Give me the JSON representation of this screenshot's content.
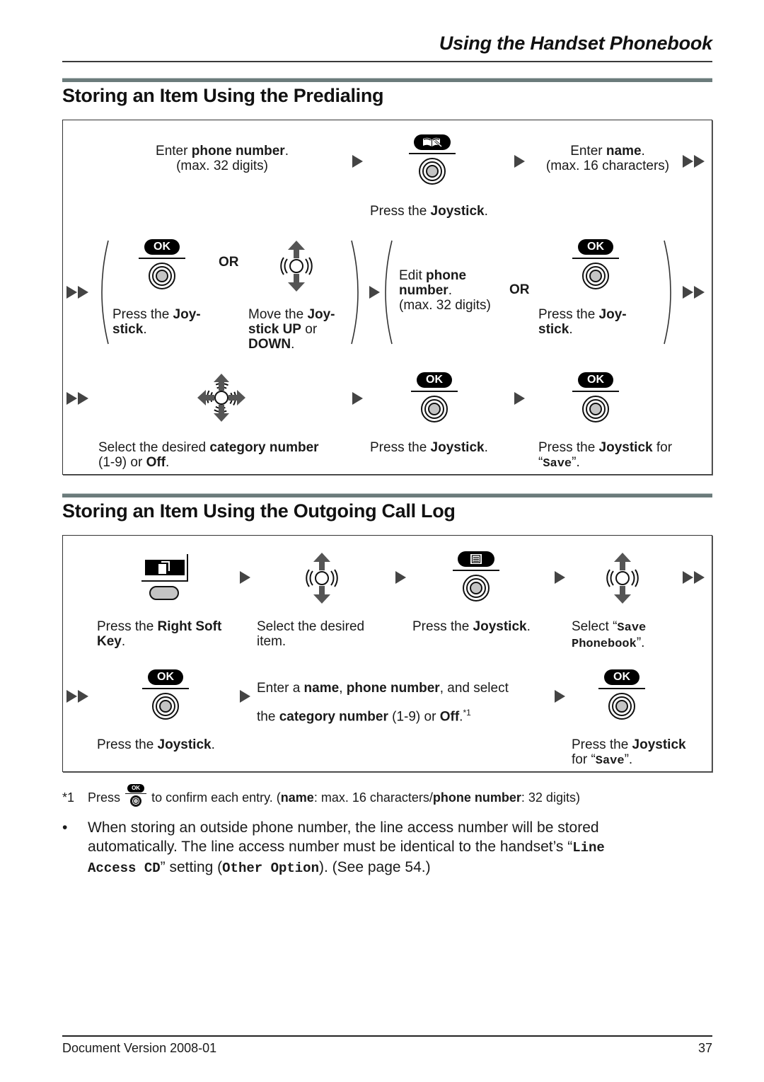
{
  "header": {
    "title": "Using the Handset Phonebook"
  },
  "section1": {
    "title": "Storing an Item Using the Predialing",
    "row1": {
      "step1": {
        "prefix": "Enter ",
        "bold": "phone number",
        "suffix": ".",
        "line2": "(max. 32 digits)"
      },
      "step2": {
        "icon": "phonebook-key-icon",
        "prefix": "Press the ",
        "bold": "Joystick",
        "suffix": "."
      },
      "step3": {
        "prefix": "Enter ",
        "bold": "name",
        "suffix": ".",
        "line2": "(max. 16 characters)"
      }
    },
    "row2": {
      "optA": {
        "key_label": "OK",
        "line1_prefix": "Press the ",
        "line1_bold": "Joy-",
        "line2_bold": "stick",
        "line2_suffix": "."
      },
      "or1": "OR",
      "optB": {
        "line1_prefix": "Move the ",
        "line1_bold": "Joy-",
        "line2_bold": "stick UP",
        "line2_suffix": " or",
        "line3_bold": "DOWN",
        "line3_suffix": "."
      },
      "optC": {
        "line1_prefix": "Edit ",
        "line1_bold": "phone",
        "line2_bold": "number",
        "line2_suffix": ".",
        "line3": "(max. 32 digits)"
      },
      "or2": "OR",
      "optD": {
        "key_label": "OK",
        "line1_prefix": "Press the ",
        "line1_bold": "Joy-",
        "line2_bold": "stick",
        "line2_suffix": "."
      }
    },
    "row3": {
      "step1": {
        "prefix": "Select the desired ",
        "bold": "category number",
        "line2_prefix": "(1-9) or ",
        "line2_bold": "Off",
        "line2_suffix": "."
      },
      "step2": {
        "key_label": "OK",
        "prefix": "Press the ",
        "bold": "Joystick",
        "suffix": "."
      },
      "step3": {
        "key_label": "OK",
        "prefix": "Press the ",
        "bold": "Joystick",
        "suffix": " for",
        "line2_open": "“",
        "line2_mono": "Save",
        "line2_close": "”."
      }
    }
  },
  "section2": {
    "title": "Storing an Item Using the Outgoing Call Log",
    "row1": {
      "step1": {
        "prefix": "Press the ",
        "bold": "Right Soft",
        "line2_bold": "Key",
        "line2_suffix": "."
      },
      "step2": {
        "line1": "Select the desired",
        "line2": "item."
      },
      "step3": {
        "prefix": "Press the ",
        "bold": "Joystick",
        "suffix": "."
      },
      "step4": {
        "prefix": "Select “",
        "mono1": "Save",
        "mono2": "Phonebook",
        "suffix": "”."
      }
    },
    "row2": {
      "step1": {
        "key_label": "OK",
        "prefix": "Press the ",
        "bold": "Joystick",
        "suffix": "."
      },
      "step2": {
        "l1_a": "Enter a ",
        "l1_b": "name",
        "l1_c": ", ",
        "l1_d": "phone number",
        "l1_e": ", and select",
        "l2_a": "the ",
        "l2_b": "category number",
        "l2_c": " (1-9) or ",
        "l2_d": "Off",
        "l2_e": ".",
        "sup": "*1"
      },
      "step3": {
        "key_label": "OK",
        "prefix": "Press the ",
        "bold": "Joystick",
        "line2_prefix": "for “",
        "line2_mono": "Save",
        "line2_suffix": "”."
      }
    }
  },
  "footnote": {
    "marker": "*1",
    "press": "Press",
    "key_label": "OK",
    "a": " to confirm each entry. (",
    "b": "name",
    "c": ": max. 16 characters/",
    "d": "phone number",
    "e": ": 32 digits)"
  },
  "note": {
    "bullet": "•",
    "l1": "When storing an outside phone number, the line access number will be stored",
    "l2": "automatically. The line access number must be identical to the handset’s “",
    "l2_mono": "Line",
    "l3_mono": "Access CD",
    "l3_a": "” setting (",
    "l3_mono2": "Other Option",
    "l3_b": "). (See page 54.)"
  },
  "footer": {
    "version": "Document Version 2008-01",
    "page": "37"
  }
}
